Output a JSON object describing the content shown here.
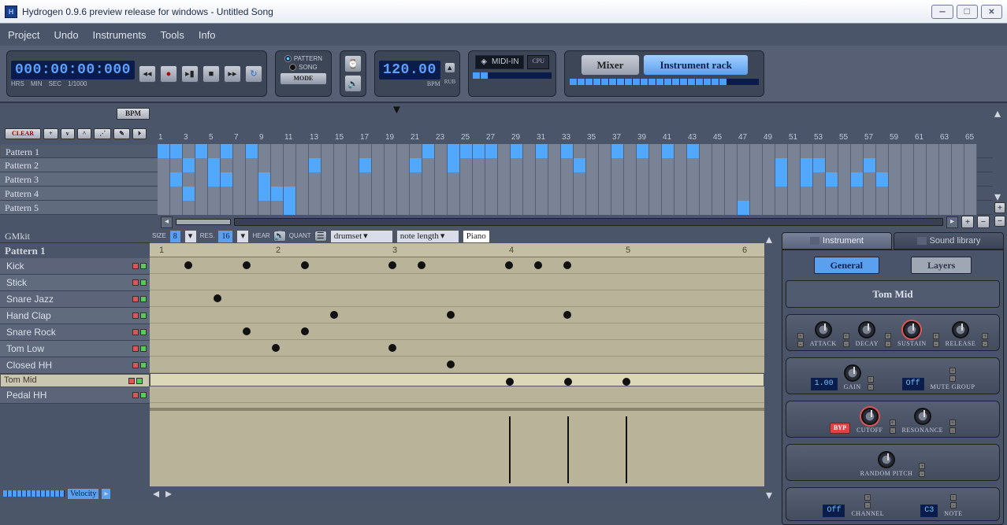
{
  "window": {
    "title": "Hydrogen 0.9.6 preview release for windows - Untitled Song"
  },
  "menu": [
    "Project",
    "Undo",
    "Instruments",
    "Tools",
    "Info"
  ],
  "transport": {
    "time": "000:00:00:000",
    "time_labels": [
      "HRS",
      "MIN",
      "SEC",
      "1/1000"
    ],
    "mode_pattern": "PATTERN",
    "mode_song": "SONG",
    "mode_btn": "MODE",
    "bpm": "120.00",
    "bpm_label": "BPM",
    "rub": "RUB",
    "midi": "MIDI-IN",
    "cpu": "CPU",
    "mixer_btn": "Mixer",
    "instrack_btn": "Instrument rack"
  },
  "song": {
    "bpm_btn": "BPM",
    "clear_btn": "CLEAR",
    "patterns": [
      "Pattern 1",
      "Pattern 2",
      "Pattern 3",
      "Pattern 4",
      "Pattern 5"
    ],
    "selected": 0,
    "cols": 65,
    "tick_every": 4,
    "cells": {
      "0": [
        1,
        2,
        4,
        6,
        8,
        22,
        24,
        25,
        26,
        27,
        29,
        31,
        33,
        37,
        39,
        41,
        43
      ],
      "1": [
        3,
        5,
        13,
        17,
        21,
        24,
        34,
        50,
        52,
        53,
        57
      ],
      "2": [
        2,
        5,
        6,
        9,
        50,
        52,
        54,
        56,
        58
      ],
      "3": [
        3,
        9,
        10,
        11
      ],
      "4": [
        11,
        47
      ]
    }
  },
  "pattern": {
    "kit": "GMkit",
    "name": "Pattern 1",
    "ctl": {
      "size_lbl": "SIZE",
      "size": "8",
      "res_lbl": "RES.",
      "res": "16",
      "hear": "HEAR",
      "quant": "QUANT",
      "drumset": "drumset",
      "notelen": "note length",
      "piano": "Piano"
    },
    "vel_label": "Velocity",
    "cols": 6,
    "instruments": [
      "Kick",
      "Stick",
      "Snare Jazz",
      "Hand Clap",
      "Snare Rock",
      "Tom Low",
      "Closed HH",
      "Tom Mid",
      "Pedal HH"
    ],
    "selected": 7,
    "notes": {
      "0": [
        0.25,
        0.75,
        1.25,
        2.0,
        2.25,
        3.0,
        3.25,
        3.5
      ],
      "2": [
        0.5
      ],
      "3": [
        1.5,
        2.5,
        3.5
      ],
      "4": [
        0.75,
        1.25
      ],
      "5": [
        1.0,
        2.0
      ],
      "6": [
        2.5
      ],
      "7": [
        3.0,
        3.5,
        4.0
      ]
    },
    "vel": [
      3.0,
      3.5,
      4.0
    ]
  },
  "side": {
    "tab_inst": "Instrument",
    "tab_lib": "Sound library",
    "sub_general": "General",
    "sub_layers": "Layers",
    "inst_name": "Tom Mid",
    "adsr": [
      "ATTACK",
      "DECAY",
      "SUSTAIN",
      "RELEASE"
    ],
    "gain": "1.00",
    "gain_lbl": "GAIN",
    "mute_val": "Off",
    "mute_lbl": "MUTE GROUP",
    "byp": "BYP",
    "cutoff": "CUTOFF",
    "res": "RESONANCE",
    "rand": "RANDOM PITCH",
    "chan_val": "Off",
    "chan_lbl": "CHANNEL",
    "note_val": "C3",
    "note_lbl": "NOTE"
  }
}
